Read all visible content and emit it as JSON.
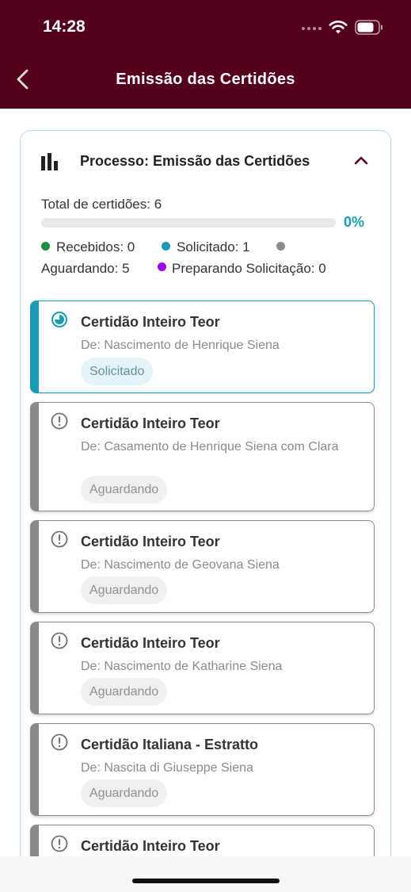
{
  "status_bar": {
    "time": "14:28"
  },
  "header": {
    "title": "Emissão das Certidões"
  },
  "process": {
    "title": "Processo: Emissão das Certidões",
    "total_label": "Total de certidões: 6",
    "progress_value": 0,
    "progress_percent": "0%",
    "legend": {
      "received": "Recebidos: 0",
      "requested": "Solicitado: 1",
      "waiting": "Aguardando: 5",
      "preparing": "Preparando Solicitação: 0"
    },
    "colors": {
      "received": "#1a8f3c",
      "requested": "#1a9bb5",
      "waiting": "#8a8a8a",
      "preparing": "#a000e6",
      "brand": "#54001c"
    }
  },
  "certificates": [
    {
      "title": "Certidão Inteiro Teor",
      "subtitle": "De: Nascimento de Henrique Siena",
      "status": "Solicitado",
      "icon": "progress-clock-icon"
    },
    {
      "title": "Certidão Inteiro Teor",
      "subtitle": "De: Casamento de Henrique Siena com Clara",
      "status": "Aguardando",
      "icon": "alert-circle-icon"
    },
    {
      "title": "Certidão Inteiro Teor",
      "subtitle": "De: Nascimento de Geovana Siena",
      "status": "Aguardando",
      "icon": "alert-circle-icon"
    },
    {
      "title": "Certidão Inteiro Teor",
      "subtitle": "De: Nascimento de Katharine Siena",
      "status": "Aguardando",
      "icon": "alert-circle-icon"
    },
    {
      "title": "Certidão Italiana - Estratto",
      "subtitle": "De: Nascita di Giuseppe Siena",
      "status": "Aguardando",
      "icon": "alert-circle-icon"
    },
    {
      "title": "Certidão Inteiro Teor",
      "icon": "alert-circle-icon"
    }
  ]
}
